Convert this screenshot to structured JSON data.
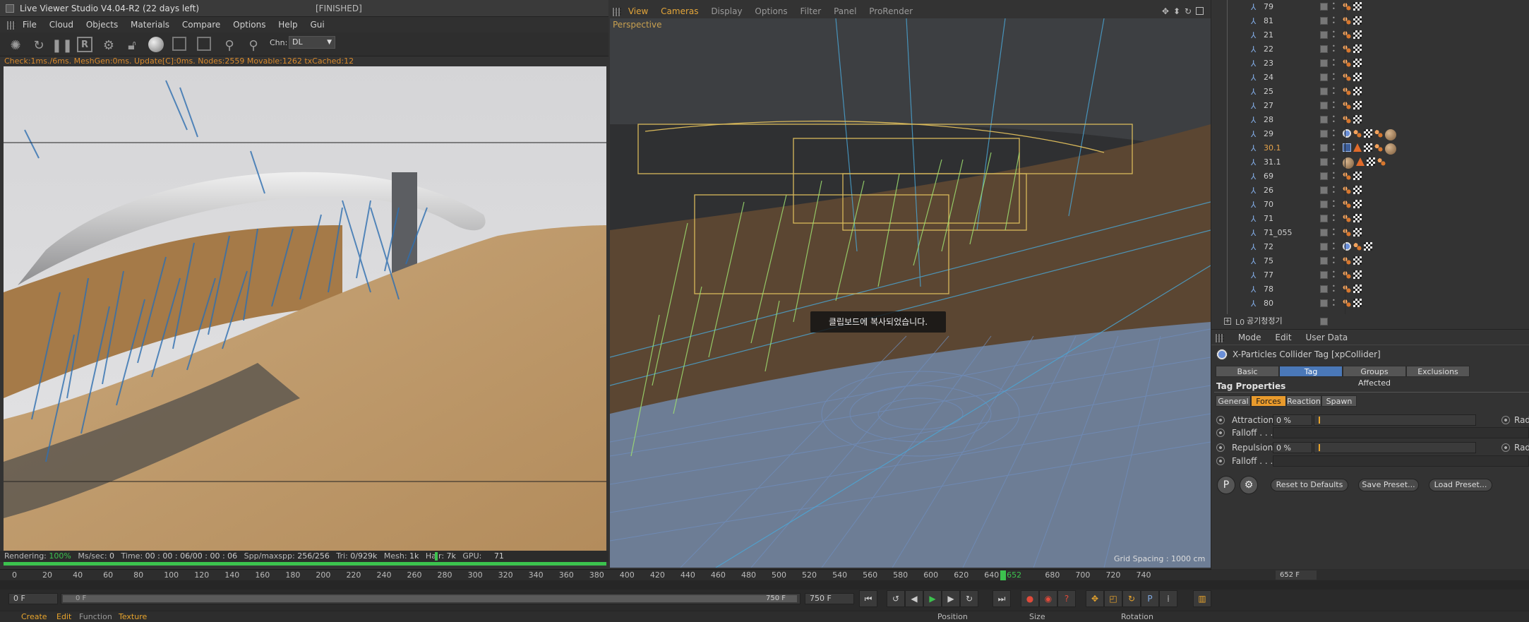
{
  "live_viewer": {
    "title": "Live Viewer Studio V4.04-R2 (22 days left)",
    "status": "[FINISHED]",
    "menu": [
      "File",
      "Cloud",
      "Objects",
      "Materials",
      "Compare",
      "Options",
      "Help",
      "Gui"
    ],
    "channel_label": "Chn:",
    "channel_value": "DL",
    "info": "Check:1ms./6ms. MeshGen:0ms. Update[C]:0ms. Nodes:2559 Movable:1262 txCached:12",
    "footer": {
      "rendering_label": "Rendering:",
      "rendering_value": "100%",
      "ms_label": "Ms/sec:",
      "ms_value": "0",
      "time_label": "Time:",
      "time_value": "00 : 00 : 06/00 : 00 : 06",
      "spp_label": "Spp/maxspp:",
      "spp_value": "256/256",
      "tri_label": "Tri:",
      "tri_value": "0/929k",
      "mesh_label": "Mesh:",
      "mesh_value": "1k",
      "hair_label": "Hair:",
      "hair_value": "7k",
      "gpu_label": "GPU:",
      "gpu_value": "71"
    }
  },
  "viewport": {
    "menu": [
      "View",
      "Cameras",
      "Display",
      "Options",
      "Filter",
      "Panel",
      "ProRender"
    ],
    "label": "Perspective",
    "grid_spacing": "Grid Spacing : 1000 cm",
    "toast": "클립보드에 복사되었습니다."
  },
  "object_manager": {
    "rows": [
      {
        "name": "79",
        "tags": [
          "orange",
          "check"
        ]
      },
      {
        "name": "81",
        "tags": [
          "orange",
          "check"
        ]
      },
      {
        "name": "21",
        "tags": [
          "orange",
          "check"
        ]
      },
      {
        "name": "22",
        "tags": [
          "orange",
          "check"
        ]
      },
      {
        "name": "23",
        "tags": [
          "orange",
          "check"
        ]
      },
      {
        "name": "24",
        "tags": [
          "orange",
          "check"
        ]
      },
      {
        "name": "25",
        "tags": [
          "orange",
          "check"
        ]
      },
      {
        "name": "27",
        "tags": [
          "orange",
          "check"
        ]
      },
      {
        "name": "28",
        "tags": [
          "orange",
          "check"
        ]
      },
      {
        "name": "29",
        "tags": [
          "xp",
          "orange",
          "check",
          "orange",
          "ball"
        ]
      },
      {
        "name": "30.1",
        "selected": true,
        "tags": [
          "xpsel",
          "tri",
          "check",
          "orange",
          "ball"
        ]
      },
      {
        "name": "31.1",
        "tags": [
          "ball",
          "tri",
          "check",
          "orange"
        ]
      },
      {
        "name": "69",
        "tags": [
          "orange",
          "check"
        ]
      },
      {
        "name": "26",
        "tags": [
          "orange",
          "check"
        ]
      },
      {
        "name": "70",
        "tags": [
          "orange",
          "check"
        ]
      },
      {
        "name": "71",
        "tags": [
          "orange",
          "check"
        ]
      },
      {
        "name": "71_055",
        "tags": [
          "orange",
          "check"
        ]
      },
      {
        "name": "72",
        "tags": [
          "xp",
          "orange",
          "check"
        ]
      },
      {
        "name": "75",
        "tags": [
          "orange",
          "check"
        ]
      },
      {
        "name": "77",
        "tags": [
          "orange",
          "check"
        ]
      },
      {
        "name": "78",
        "tags": [
          "orange",
          "check"
        ]
      },
      {
        "name": "80",
        "tags": [
          "orange",
          "check"
        ]
      }
    ],
    "group": "공기청정기"
  },
  "attribute_manager": {
    "menu": [
      "Mode",
      "Edit",
      "User Data"
    ],
    "title": "X-Particles Collider Tag [xpCollider]",
    "tabs": [
      "Basic",
      "Tag",
      "Groups Affected",
      "Exclusions"
    ],
    "section": "Tag Properties",
    "subtabs": [
      "General",
      "Forces",
      "Reaction",
      "Spawn"
    ],
    "attraction_label": "Attraction",
    "attraction_value": "0 %",
    "attraction_pct": 0,
    "falloff_label": "Falloff . . .",
    "repulsion_label": "Repulsion",
    "repulsion_value": "0 %",
    "repulsion_pct": 0,
    "radius_label": "Radi",
    "reset_button": "Reset to Defaults",
    "save_button": "Save Preset...",
    "load_button": "Load Preset..."
  },
  "timeline": {
    "ticks": [
      "0",
      "20",
      "40",
      "60",
      "80",
      "100",
      "120",
      "140",
      "160",
      "180",
      "200",
      "220",
      "240",
      "260",
      "280",
      "300",
      "320",
      "340",
      "360",
      "380",
      "400",
      "420",
      "440",
      "460",
      "480",
      "500",
      "520",
      "540",
      "560",
      "580",
      "600",
      "620",
      "640",
      "652",
      "680",
      "700",
      "720",
      "740"
    ],
    "current_frame": "652 F",
    "start_field": "0 F",
    "range_start": "0 F",
    "range_end": "750 F",
    "end_field": "750 F"
  },
  "bottom": {
    "tabs": [
      "Create",
      "Edit",
      "Function",
      "Texture"
    ],
    "columns": [
      "Position",
      "Size",
      "Rotation"
    ]
  },
  "colors": {
    "accent_orange": "#e89a2c",
    "accent_blue": "#4a78b8",
    "progress_green": "#3cc24e"
  }
}
